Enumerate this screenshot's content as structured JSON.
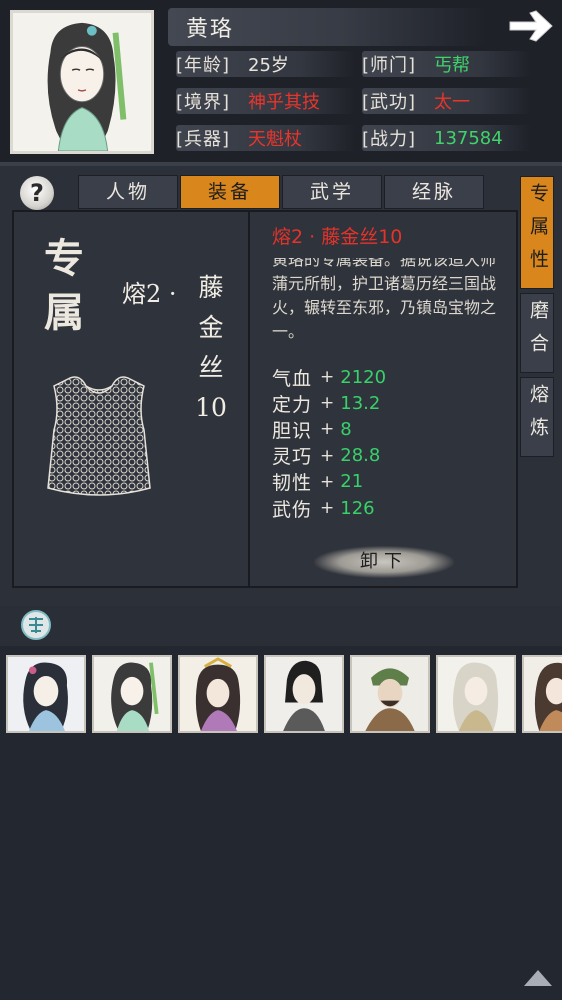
{
  "hero": {
    "name": "黄珞",
    "stats": [
      {
        "label": "[年龄]",
        "value": "25岁",
        "color": "white"
      },
      {
        "label": "[师门]",
        "value": "丐帮",
        "color": "green"
      },
      {
        "label": "[境界]",
        "value": "神乎其技",
        "color": "red"
      },
      {
        "label": "[武功]",
        "value": "太一",
        "color": "red"
      },
      {
        "label": "[兵器]",
        "value": "天魁杖",
        "color": "red"
      },
      {
        "label": "[战力]",
        "value": "137584",
        "color": "green"
      }
    ]
  },
  "icons": {
    "next": "arrow-right-icon",
    "help": "question-icon",
    "seal": "seal-icon",
    "scroll_top": "triangle-up-icon"
  },
  "help_label": "?",
  "tabs": [
    {
      "label": "人物",
      "active": false
    },
    {
      "label": "装备",
      "active": true
    },
    {
      "label": "武学",
      "active": false
    },
    {
      "label": "经脉",
      "active": false
    }
  ],
  "side_tabs": [
    {
      "label": "专属性",
      "active": true
    },
    {
      "label": "磨合",
      "active": false
    },
    {
      "label": "熔炼",
      "active": false
    }
  ],
  "item": {
    "badge": "专属",
    "badge_chars": [
      "专",
      "属"
    ],
    "title_prefix": "熔2 ·",
    "title_vertical": [
      "藤",
      "金",
      "丝",
      "10"
    ],
    "detail_title": "熔2 · 藤金丝10",
    "description": "黄珞的专属装备。据说该造大师蒲元所制，护卫诸葛历经三国战火，辗转至东邪，乃镇岛宝物之一。",
    "attributes": [
      {
        "name": "气血",
        "value": "2120"
      },
      {
        "name": "定力",
        "value": "13.2"
      },
      {
        "name": "胆识",
        "value": "8"
      },
      {
        "name": "灵巧",
        "value": "28.8"
      },
      {
        "name": "韧性",
        "value": "21"
      },
      {
        "name": "武伤",
        "value": "126"
      }
    ],
    "unequip_label": "卸下"
  },
  "roster_count": 7,
  "colors": {
    "accent": "#d9861c",
    "red": "#e8352c",
    "green": "#3fd36b",
    "bg": "#232730"
  }
}
